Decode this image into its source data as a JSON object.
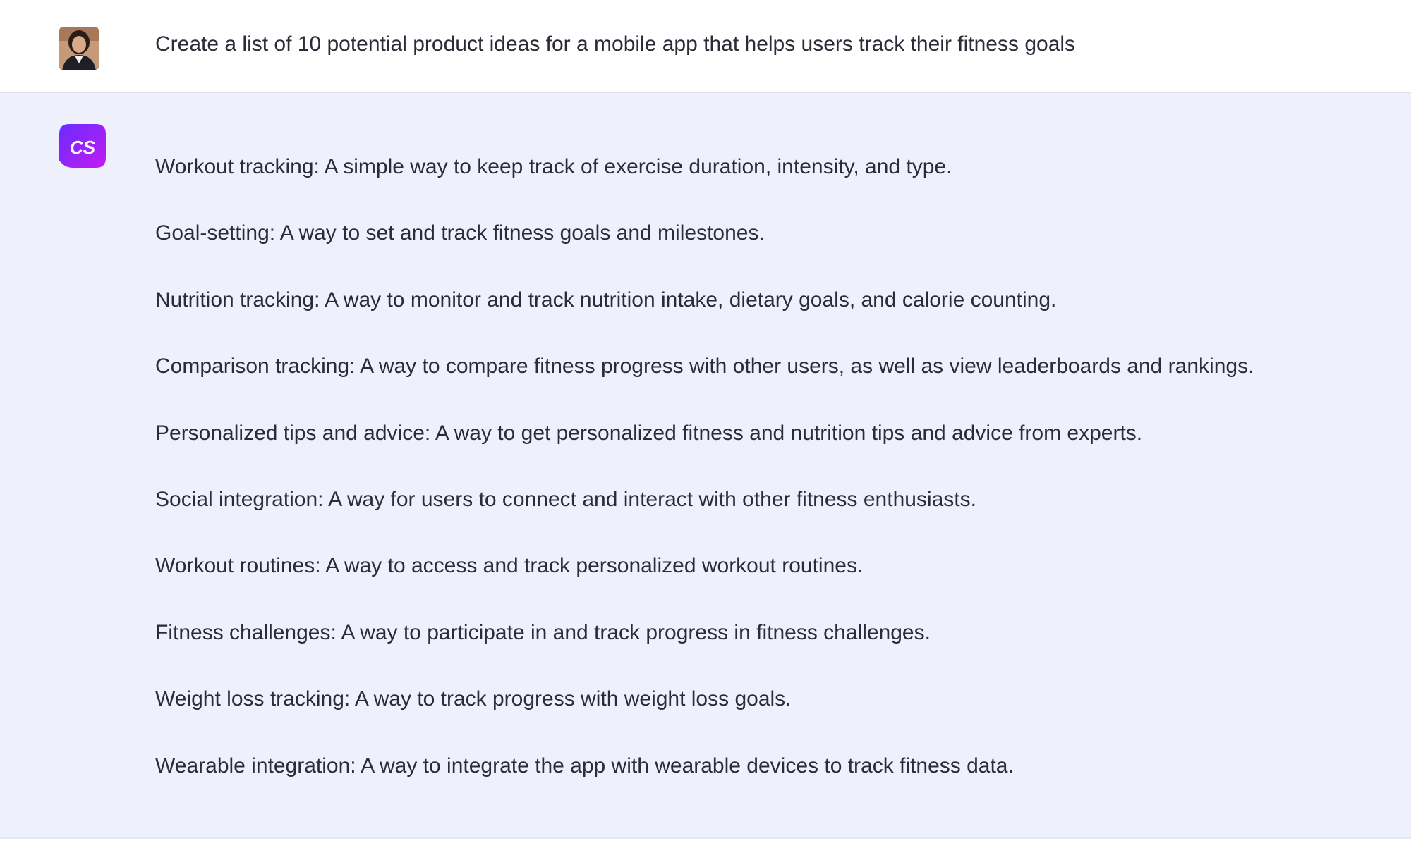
{
  "user_message": {
    "avatar_icon": "user-avatar",
    "text": "Create a list of 10 potential product ideas for a mobile app that helps users track their fitness goals"
  },
  "assistant_message": {
    "logo_icon": "cs-logo",
    "logo_text": "CS",
    "items": [
      "Workout tracking: A simple way to keep track of exercise duration, intensity, and type.",
      "Goal-setting: A way to set and track fitness goals and milestones.",
      "Nutrition tracking: A way to monitor and track nutrition intake, dietary goals, and calorie counting.",
      "Comparison tracking: A way to compare fitness progress with other users, as well as view leaderboards and rankings.",
      "Personalized tips and advice: A way to get personalized fitness and nutrition tips and advice from experts.",
      "Social integration: A way for users to connect and interact with other fitness enthusiasts.",
      "Workout routines: A way to access and track personalized workout routines.",
      "Fitness challenges: A way to participate in and track progress in fitness challenges.",
      "Weight loss tracking: A way to track progress with weight loss goals.",
      "Wearable integration: A way to integrate the app with wearable devices to track fitness data."
    ]
  },
  "colors": {
    "user_bg": "#ffffff",
    "assistant_bg": "#eef1fc",
    "text": "#2c2c38",
    "logo_gradient_start": "#6a2bff",
    "logo_gradient_end": "#c01cf2"
  }
}
